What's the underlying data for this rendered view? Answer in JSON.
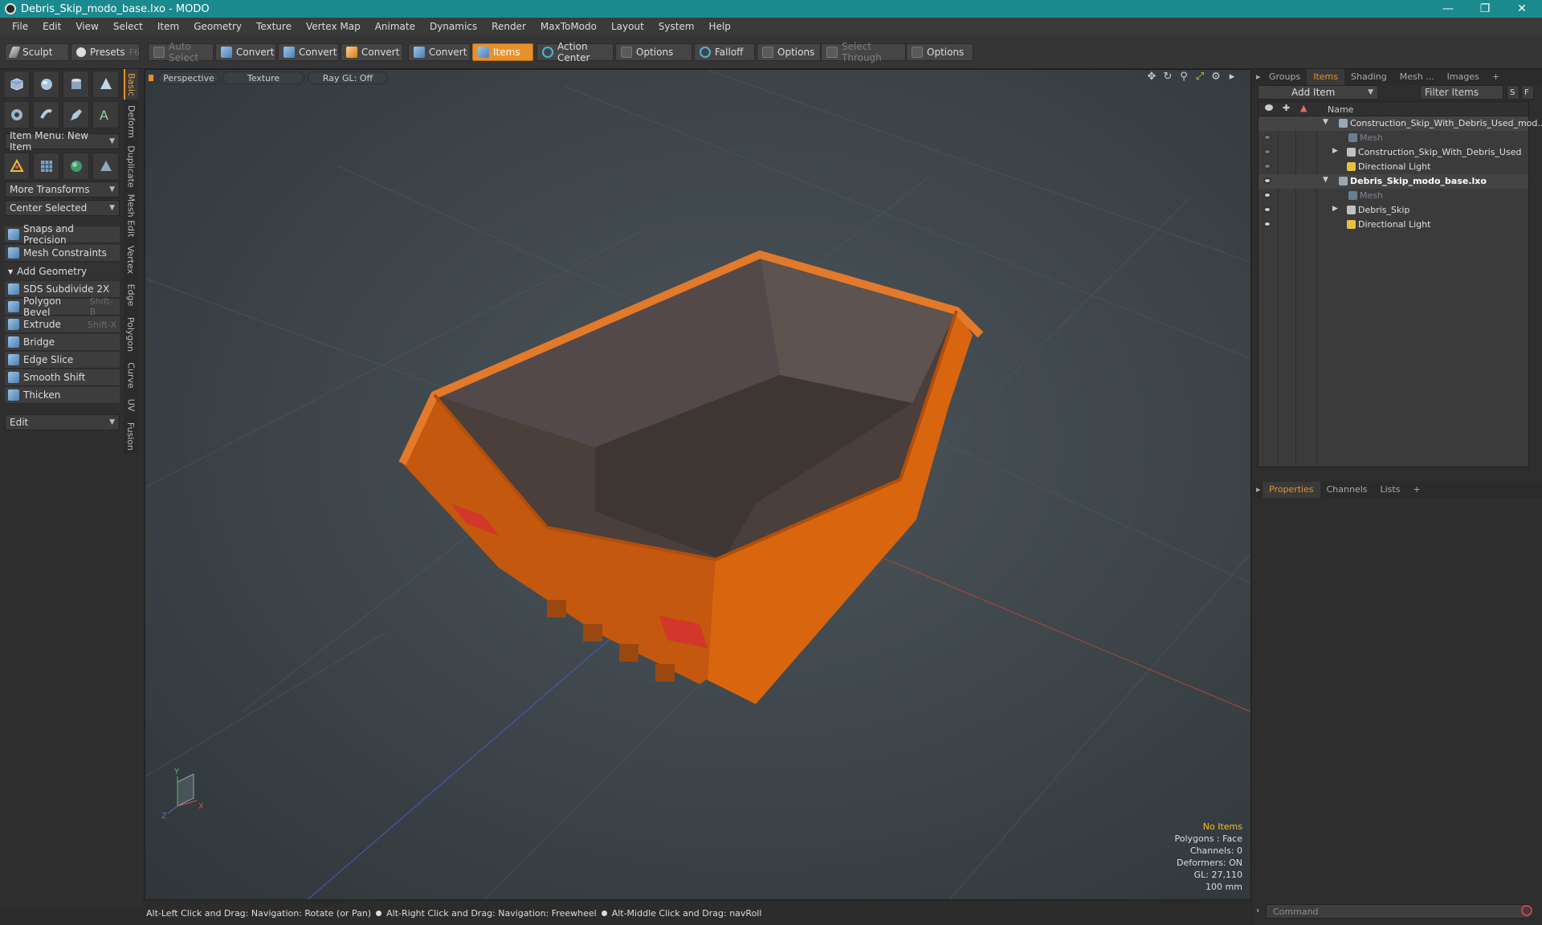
{
  "window": {
    "title": "Debris_Skip_modo_base.lxo - MODO"
  },
  "menu": [
    "File",
    "Edit",
    "View",
    "Select",
    "Item",
    "Geometry",
    "Texture",
    "Vertex Map",
    "Animate",
    "Dynamics",
    "Render",
    "MaxToModo",
    "Layout",
    "System",
    "Help"
  ],
  "toolbar": {
    "sculpt": "Sculpt",
    "presets": "Presets",
    "presets_key": "F6",
    "auto_select": "Auto Select",
    "convert1": "Convert",
    "convert2": "Convert",
    "convert3": "Convert",
    "convert4": "Convert",
    "items": "Items",
    "action_center": "Action Center",
    "options1": "Options",
    "falloff": "Falloff",
    "options2": "Options",
    "select_through": "Select Through",
    "options3": "Options"
  },
  "left": {
    "item_menu": "Item Menu: New Item",
    "more_transforms": "More Transforms",
    "center_selected": "Center Selected",
    "snaps": "Snaps and Precision",
    "mesh_constraints": "Mesh Constraints",
    "add_geometry": "Add Geometry",
    "tools": [
      {
        "label": "SDS Subdivide 2X",
        "key": ""
      },
      {
        "label": "Polygon Bevel",
        "key": "Shift-B"
      },
      {
        "label": "Extrude",
        "key": "Shift-X"
      },
      {
        "label": "Bridge",
        "key": ""
      },
      {
        "label": "Edge Slice",
        "key": ""
      },
      {
        "label": "Smooth Shift",
        "key": ""
      },
      {
        "label": "Thicken",
        "key": ""
      }
    ],
    "edit": "Edit",
    "vtabs": [
      "Basic",
      "Deform",
      "Duplicate",
      "Mesh Edit",
      "Vertex",
      "Edge",
      "Polygon",
      "Curve",
      "UV",
      "Fusion"
    ]
  },
  "viewport": {
    "view": "Perspective",
    "shading": "Texture",
    "raygl": "Ray GL: Off",
    "axis_y": "Y",
    "axis_x": "X",
    "axis_z": "Z",
    "stats": {
      "selection": "No Items",
      "polygons": "Polygons : Face",
      "channels": "Channels: 0",
      "deformers": "Deformers: ON",
      "gl": "GL: 27,110",
      "scale": "100 mm"
    }
  },
  "status": {
    "hint1": "Alt-Left Click and Drag: Navigation: Rotate (or Pan)",
    "hint2": "Alt-Right Click and Drag: Navigation: Freewheel",
    "hint3": "Alt-Middle Click and Drag: navRoll"
  },
  "right": {
    "tabs": [
      "Groups",
      "Items",
      "Shading",
      "Mesh ...",
      "Images"
    ],
    "add_item": "Add Item",
    "filter_items": "Filter Items",
    "btn_s": "S",
    "btn_f": "F",
    "col_name": "Name",
    "tree": [
      {
        "label": "Construction_Skip_With_Debris_Used_mod...",
        "level": 0,
        "type": "scene",
        "expanded": true,
        "style": ""
      },
      {
        "label": "Mesh",
        "level": 1,
        "type": "mesh",
        "style": "dim"
      },
      {
        "label": "Construction_Skip_With_Debris_Used",
        "level": 1,
        "type": "group",
        "expanded": false,
        "style": ""
      },
      {
        "label": "Directional Light",
        "level": 1,
        "type": "light",
        "style": ""
      },
      {
        "label": "Debris_Skip_modo_base.lxo",
        "level": 0,
        "type": "scene",
        "expanded": true,
        "style": "bold"
      },
      {
        "label": "Mesh",
        "level": 1,
        "type": "mesh",
        "style": "dim"
      },
      {
        "label": "Debris_Skip",
        "level": 1,
        "type": "group",
        "expanded": false,
        "style": ""
      },
      {
        "label": "Directional Light",
        "level": 1,
        "type": "light",
        "style": ""
      }
    ],
    "bottom_tabs": [
      "Properties",
      "Channels",
      "Lists"
    ],
    "command_placeholder": "Command"
  },
  "colors": {
    "accent": "#e8912a",
    "titlebar": "#1b8a8e",
    "skip_orange": "#d9650f"
  }
}
